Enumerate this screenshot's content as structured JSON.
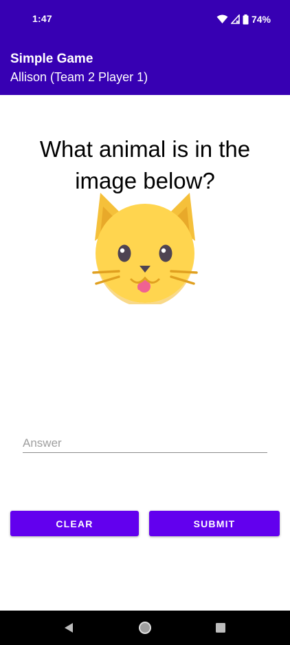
{
  "status_bar": {
    "time": "1:47",
    "battery": "74%",
    "icons": [
      "wifi-icon",
      "signal-icon",
      "battery-icon"
    ]
  },
  "app_bar": {
    "title": "Simple Game",
    "subtitle": "Allison (Team 2 Player 1)",
    "color": "#3700b3"
  },
  "question": {
    "text": "What animal is in the image below?",
    "image_icon": "cat-face-icon"
  },
  "answer": {
    "placeholder": "Answer",
    "value": ""
  },
  "buttons": {
    "clear_label": "CLEAR",
    "submit_label": "SUBMIT",
    "color": "#6200ee"
  },
  "nav_bar": {
    "icons": [
      "back-icon",
      "home-icon",
      "recents-icon"
    ]
  }
}
